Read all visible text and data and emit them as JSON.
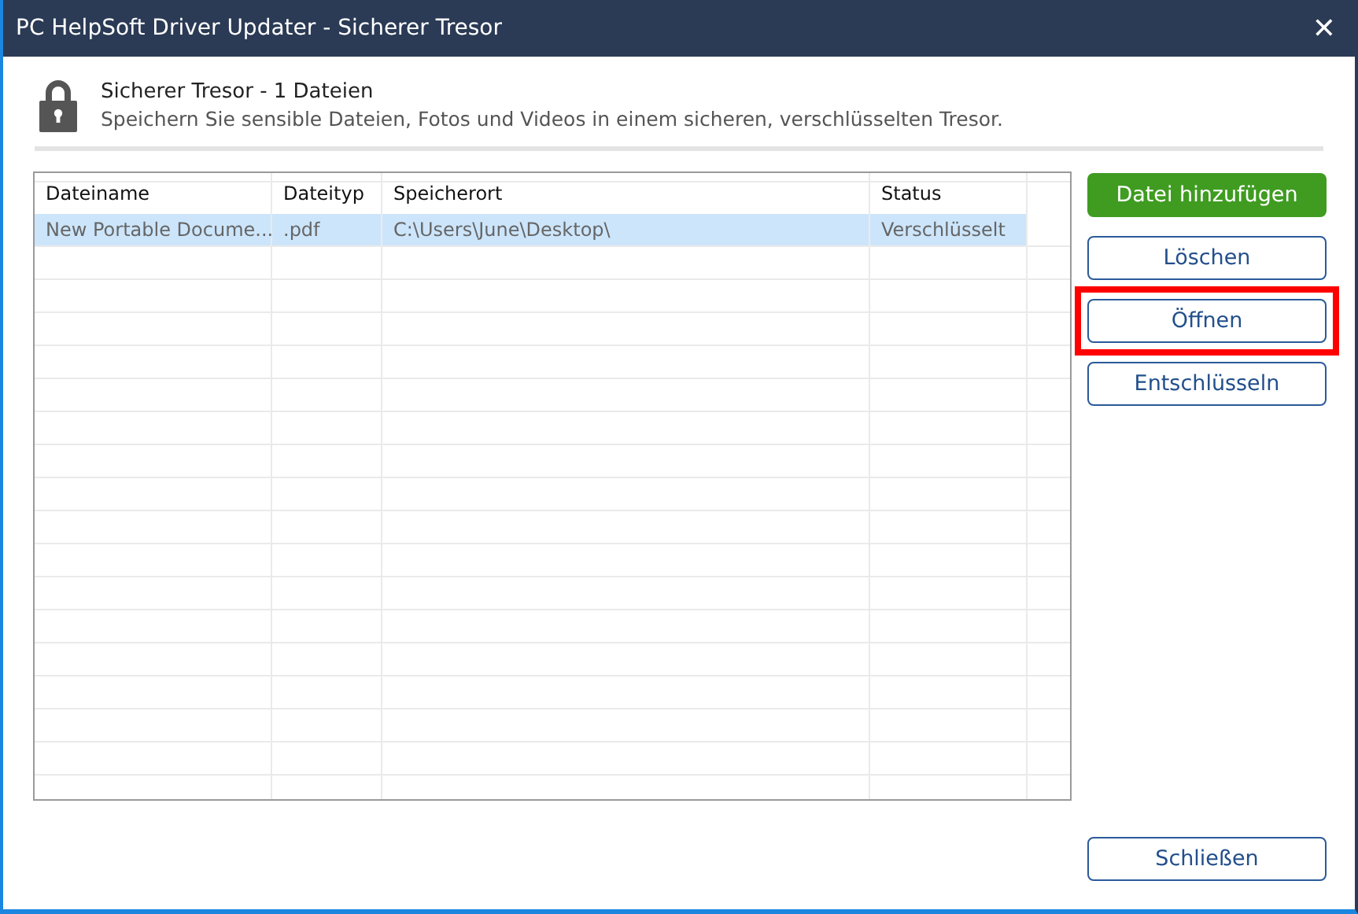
{
  "window": {
    "title": "PC HelpSoft Driver Updater - Sicherer Tresor",
    "close": "✕"
  },
  "header": {
    "title": "Sicherer Tresor - 1 Dateien",
    "subtitle": "Speichern Sie sensible Dateien, Fotos und Videos in einem sicheren, verschlüsselten Tresor."
  },
  "table": {
    "columns": [
      "Dateiname",
      "Dateityp",
      "Speicherort",
      "Status"
    ],
    "rows": [
      {
        "cells": [
          "New Portable Docume...",
          ".pdf",
          "C:\\Users\\June\\Desktop\\",
          "Verschlüsselt"
        ],
        "selected": true
      }
    ]
  },
  "actions": [
    {
      "label": "Datei hinzufügen",
      "kind": "primary",
      "highlighted": false
    },
    {
      "label": "Löschen",
      "kind": "outline",
      "highlighted": false
    },
    {
      "label": "Öffnen",
      "kind": "outline",
      "highlighted": true
    },
    {
      "label": "Entschlüsseln",
      "kind": "outline",
      "highlighted": false
    }
  ],
  "footer": {
    "close_label": "Schließen"
  }
}
